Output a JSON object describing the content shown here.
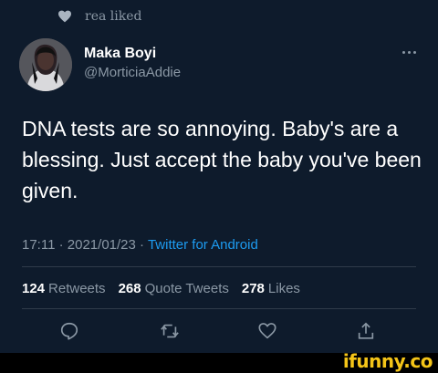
{
  "liked_line": {
    "text": "rea liked"
  },
  "author": {
    "name": "Maka Boyi",
    "handle": "@MorticiaAddie"
  },
  "tweet": {
    "text": "DNA tests are so annoying. Baby's are a blessing. Just accept the baby you've been given."
  },
  "meta": {
    "time": "17:11",
    "separator": "·",
    "date": "2021/01/23",
    "source": "Twitter for Android"
  },
  "stats": {
    "retweets_count": "124",
    "retweets_label": "Retweets",
    "quote_count": "268",
    "quote_label": "Quote Tweets",
    "likes_count": "278",
    "likes_label": "Likes"
  },
  "actions": [
    "reply-icon",
    "retweet-icon",
    "like-icon",
    "share-icon"
  ],
  "watermark": {
    "text": "ifunny.co"
  },
  "colors": {
    "background": "#0e1b2c",
    "secondary_text": "#8b98a5",
    "link": "#1d9bf0",
    "watermark": "#f5c518"
  }
}
